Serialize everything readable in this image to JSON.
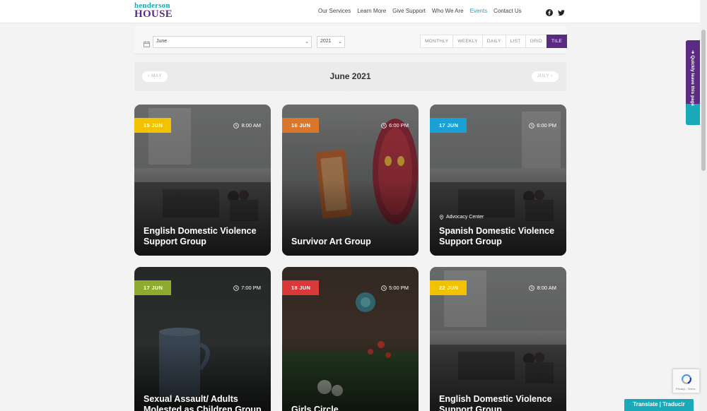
{
  "brand": {
    "line1": "henderson",
    "line2": "HOUSE"
  },
  "nav": [
    "Our Services",
    "Learn More",
    "Give Support",
    "Who We Are",
    "Events",
    "Contact Us"
  ],
  "nav_active": "Events",
  "social": [
    "facebook-icon",
    "twitter-icon"
  ],
  "filter": {
    "month_value": "June",
    "year_value": "2021",
    "views": [
      "MONTHLY",
      "WEEKLY",
      "DAILY",
      "LIST",
      "GRID",
      "TILE"
    ],
    "active_view": "TILE"
  },
  "month_nav": {
    "prev": "MAY",
    "title": "June 2021",
    "next": "JULY"
  },
  "events": [
    {
      "date": "15 JUN",
      "time": "8:00 AM",
      "venue": "",
      "title": "English Domestic Violence Support Group",
      "badge_color": "#f2c200"
    },
    {
      "date": "16 JUN",
      "time": "6:00 PM",
      "venue": "",
      "title": "Survivor Art Group",
      "badge_color": "#d9782d"
    },
    {
      "date": "17 JUN",
      "time": "6:00 PM",
      "venue": "Advocacy Center",
      "title": "Spanish Domestic Violence Support Group",
      "badge_color": "#1a9fd6"
    },
    {
      "date": "17 JUN",
      "time": "7:00 PM",
      "venue": "",
      "title": "Sexual Assault/ Adults Molested as Children Group",
      "badge_color": "#8dab2e"
    },
    {
      "date": "18 JUN",
      "time": "5:00 PM",
      "venue": "",
      "title": "Girls Circle",
      "badge_color": "#d83a3a"
    },
    {
      "date": "22 JUN",
      "time": "8:00 AM",
      "venue": "",
      "title": "English Domestic Violence Support Group",
      "badge_color": "#f2c200"
    }
  ],
  "quick_leave": "Quickly leave this page",
  "recaptcha": "Privacy - Terms",
  "translate": "Translate | Traducir"
}
